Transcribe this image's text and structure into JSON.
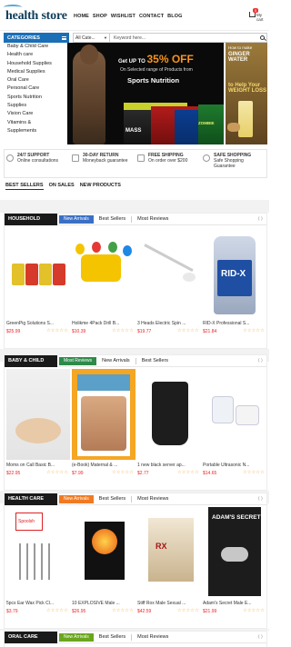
{
  "header": {
    "logo": "health store",
    "nav": [
      "HOME",
      "SHOP",
      "WISHLIST",
      "CONTACT",
      "BLOG"
    ],
    "cart_count": "0",
    "cart_label_1": "My",
    "cart_label_2": "cart"
  },
  "categories_button": "CATEGORIES",
  "search": {
    "category": "All Cate...",
    "placeholder": "Keyword here..."
  },
  "sidebar_categories": [
    "Baby & Child Care",
    "Health care",
    "Household Supplies",
    "Medical Supplies",
    "Oral Care",
    "Personal Care",
    "Sports Nutrition",
    "Supplies",
    "Vision Care",
    "Vitamins &",
    "Supplements"
  ],
  "banner": {
    "line1_pre": "Get UP TO",
    "line1_pct": "35% OFF",
    "line2": "On Selected range of Products from",
    "line3": "Sports Nutrition",
    "prod1": "MASS",
    "prod4": "ZOMBIE"
  },
  "banner2": {
    "line1": "How to make",
    "line2": "GINGER WATER",
    "line3": "to Help Your WEIGHT LOSS"
  },
  "features": [
    {
      "title": "24/7 SUPPORT",
      "sub": "Online consultations"
    },
    {
      "title": "30-DAY RETURN",
      "sub": "Moneyback guarantee"
    },
    {
      "title": "FREE SHIPPING",
      "sub": "On order over $200"
    },
    {
      "title": "SAFE SHOPPING",
      "sub": "Safe Shopping Guarantee"
    }
  ],
  "subtabs": [
    "BEST SELLERS",
    "ON SALES",
    "NEW PRODUCTS"
  ],
  "sections": [
    {
      "title": "HOUSEHOLD",
      "badge": "New Arrivals",
      "badge_color": "#3a6fc4",
      "tabs": [
        "Best Sellers",
        "Most Reviews"
      ],
      "products": [
        {
          "name": "GreenPig Solutions S...",
          "price": "$25.99"
        },
        {
          "name": "Holikme 4Pack Drill B...",
          "price": "$10.39"
        },
        {
          "name": "3 Heads Electric Spin ...",
          "price": "$19.77"
        },
        {
          "name": "RID-X Professional S...",
          "price": "$21.84"
        }
      ]
    },
    {
      "title": "BABY & CHILD",
      "badge": "Most Reviews",
      "badge_color": "#2e8a4a",
      "tabs": [
        "New Arrivals",
        "Best Sellers"
      ],
      "products": [
        {
          "name": "Moms on Call Basic B...",
          "price": "$22.95"
        },
        {
          "name": "(e-Book) Maternal & ...",
          "price": "$7.99"
        },
        {
          "name": "1 new black server ap...",
          "price": "$2.77"
        },
        {
          "name": "Portable Ultrasonic N...",
          "price": "$14.65"
        }
      ]
    },
    {
      "title": "HEALTH CARE",
      "badge": "New Arrivals",
      "badge_color": "#f07a22",
      "tabs": [
        "Best Sellers",
        "Most Reviews"
      ],
      "products": [
        {
          "name": "5pcs Ear Wax Pick Cl...",
          "price": "$3.79"
        },
        {
          "name": "10 EXPLOSIVE Male ...",
          "price": "$26.95"
        },
        {
          "name": "Stiff Rox Male Sexual ...",
          "price": "$42.59"
        },
        {
          "name": "Adam's Secret Male E...",
          "price": "$21.99"
        }
      ]
    },
    {
      "title": "ORAL CARE",
      "badge": "New Arrivals",
      "badge_color": "#6aa61e",
      "tabs": [
        "Best Sellers",
        "Most Reviews"
      ],
      "products": []
    }
  ],
  "product_text": {
    "earwax_label": "Spoolsh",
    "stiff_label": "RX",
    "adam_label": "ADAM'S SECRET",
    "jug_label": "RID-X"
  },
  "stars": "☆☆☆☆☆",
  "arrows": "⟨ ⟩",
  "colors": {
    "brand": "#1a6fb7",
    "price": "#e22222",
    "stars": "#f0a020"
  }
}
